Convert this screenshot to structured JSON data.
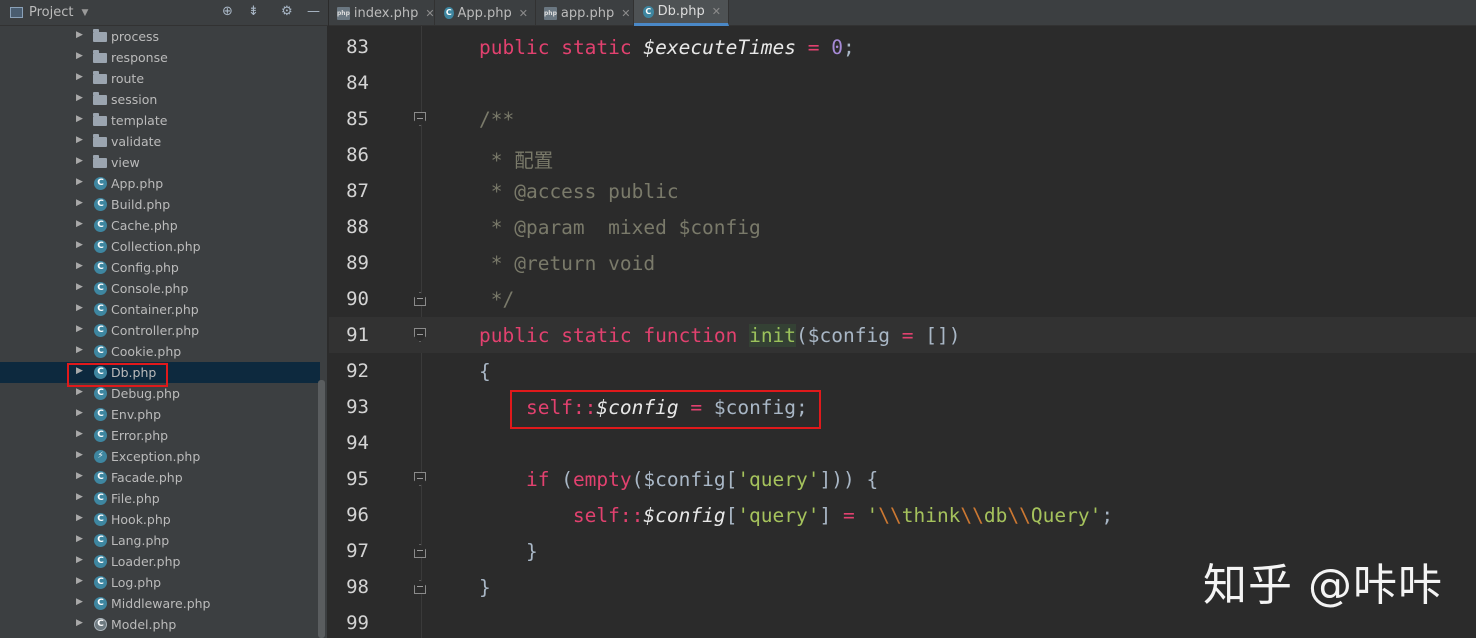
{
  "sidebar": {
    "title": "Project",
    "header_icons": [
      "target-icon",
      "collapse-icon",
      "gear-icon",
      "minimize-icon"
    ],
    "items": [
      {
        "label": "process",
        "type": "folder"
      },
      {
        "label": "response",
        "type": "folder"
      },
      {
        "label": "route",
        "type": "folder"
      },
      {
        "label": "session",
        "type": "folder"
      },
      {
        "label": "template",
        "type": "folder"
      },
      {
        "label": "validate",
        "type": "folder"
      },
      {
        "label": "view",
        "type": "folder"
      },
      {
        "label": "App.php",
        "type": "class"
      },
      {
        "label": "Build.php",
        "type": "class"
      },
      {
        "label": "Cache.php",
        "type": "class"
      },
      {
        "label": "Collection.php",
        "type": "class"
      },
      {
        "label": "Config.php",
        "type": "class"
      },
      {
        "label": "Console.php",
        "type": "class"
      },
      {
        "label": "Container.php",
        "type": "class"
      },
      {
        "label": "Controller.php",
        "type": "class"
      },
      {
        "label": "Cookie.php",
        "type": "class"
      },
      {
        "label": "Db.php",
        "type": "class",
        "selected": true
      },
      {
        "label": "Debug.php",
        "type": "class"
      },
      {
        "label": "Env.php",
        "type": "class"
      },
      {
        "label": "Error.php",
        "type": "class"
      },
      {
        "label": "Exception.php",
        "type": "exception"
      },
      {
        "label": "Facade.php",
        "type": "class"
      },
      {
        "label": "File.php",
        "type": "class"
      },
      {
        "label": "Hook.php",
        "type": "class"
      },
      {
        "label": "Lang.php",
        "type": "class"
      },
      {
        "label": "Loader.php",
        "type": "class"
      },
      {
        "label": "Log.php",
        "type": "class"
      },
      {
        "label": "Middleware.php",
        "type": "class"
      },
      {
        "label": "Model.php",
        "type": "abstract"
      }
    ]
  },
  "tabs": [
    {
      "label": "index.php",
      "icon": "php-file-icon",
      "active": false
    },
    {
      "label": "App.php",
      "icon": "class-icon",
      "active": false
    },
    {
      "label": "app.php",
      "icon": "php-file-icon",
      "active": false
    },
    {
      "label": "Db.php",
      "icon": "class-icon",
      "active": true
    }
  ],
  "editor": {
    "current_line": 91,
    "lines": [
      {
        "num": "83",
        "text": "public static $executeTimes = 0;"
      },
      {
        "num": "84",
        "text": ""
      },
      {
        "num": "85",
        "text": "/**"
      },
      {
        "num": "86",
        "text": " * 配置"
      },
      {
        "num": "87",
        "text": " * @access public"
      },
      {
        "num": "88",
        "text": " * @param  mixed $config"
      },
      {
        "num": "89",
        "text": " * @return void"
      },
      {
        "num": "90",
        "text": " */"
      },
      {
        "num": "91",
        "text": "public static function init($config = [])"
      },
      {
        "num": "92",
        "text": "{"
      },
      {
        "num": "93",
        "text": "    self::$config = $config;"
      },
      {
        "num": "94",
        "text": ""
      },
      {
        "num": "95",
        "text": "    if (empty($config['query'])) {"
      },
      {
        "num": "96",
        "text": "        self::$config['query'] = '\\\\think\\\\db\\\\Query';"
      },
      {
        "num": "97",
        "text": "    }"
      },
      {
        "num": "98",
        "text": "}"
      },
      {
        "num": "99",
        "text": ""
      }
    ]
  },
  "watermark": "知乎 @咔咔",
  "colors": {
    "background": "#2b2b2b",
    "sidebar": "#3c3f41",
    "selection": "#0d293e",
    "keyword": "#e2416f",
    "doc_comment": "#7a7a6a",
    "function": "#9bc25b",
    "string": "#a5c25c",
    "number": "#a68ad6",
    "highlight_box": "#e0191b"
  }
}
